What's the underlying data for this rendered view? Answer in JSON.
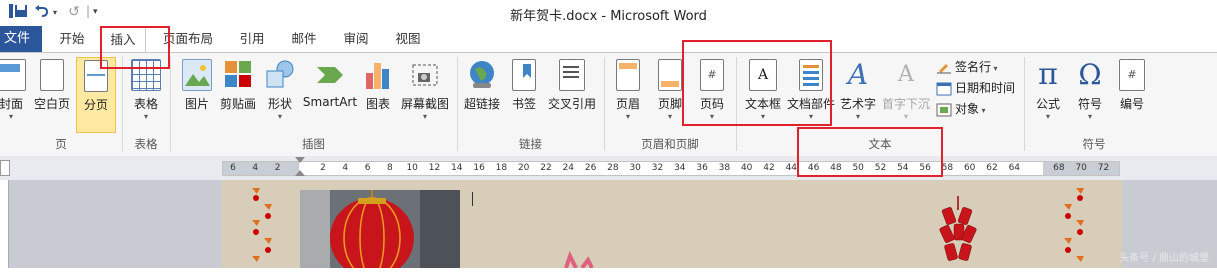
{
  "window": {
    "title": "新年贺卡.docx  -  Microsoft Word"
  },
  "quick_access": [
    {
      "name": "save-icon",
      "glyph": "💾"
    },
    {
      "name": "undo-icon",
      "glyph": "↶"
    },
    {
      "name": "redo-icon",
      "glyph": "↺"
    },
    {
      "name": "customize-icon",
      "glyph": "▾"
    }
  ],
  "tabs": {
    "file": "文件",
    "items": [
      "开始",
      "插入",
      "页面布局",
      "引用",
      "邮件",
      "审阅",
      "视图"
    ],
    "active": "插入"
  },
  "ribbon": {
    "groups": {
      "pages": "页",
      "tables": "表格",
      "illustrations": "插图",
      "links": "链接",
      "header_footer": "页眉和页脚",
      "text": "文本",
      "symbols": "符号"
    },
    "buttons": {
      "cover": "封面",
      "blank_page": "空白页",
      "page_break": "分页",
      "table": "表格",
      "picture": "图片",
      "clipart": "剪贴画",
      "shapes": "形状",
      "smartart": "SmartArt",
      "chart": "图表",
      "screenshot": "屏幕截图",
      "hyperlink": "超链接",
      "bookmark": "书签",
      "cross_ref": "交叉引用",
      "header": "页眉",
      "footer": "页脚",
      "page_number": "页码",
      "textbox": "文本框",
      "quick_parts": "文档部件",
      "wordart": "艺术字",
      "dropcap": "首字下沉",
      "signature": "签名行",
      "datetime": "日期和时间",
      "object": "对象",
      "equation": "公式",
      "symbol": "符号",
      "numbering": "编号"
    },
    "accent_color": "#2b579a",
    "annotation_color": "#e0212e"
  },
  "ruler": {
    "left_labels": [
      "6",
      "4",
      "2"
    ],
    "labels": [
      "2",
      "4",
      "6",
      "8",
      "10",
      "12",
      "14",
      "16",
      "18",
      "20",
      "22",
      "24",
      "26",
      "28",
      "30",
      "32",
      "34",
      "36",
      "38",
      "40",
      "42",
      "44",
      "46",
      "48",
      "50",
      "52",
      "54",
      "56",
      "58",
      "60",
      "62",
      "64",
      "68",
      "70",
      "72"
    ]
  },
  "watermark": "头条号 / 鼎山的城堡"
}
